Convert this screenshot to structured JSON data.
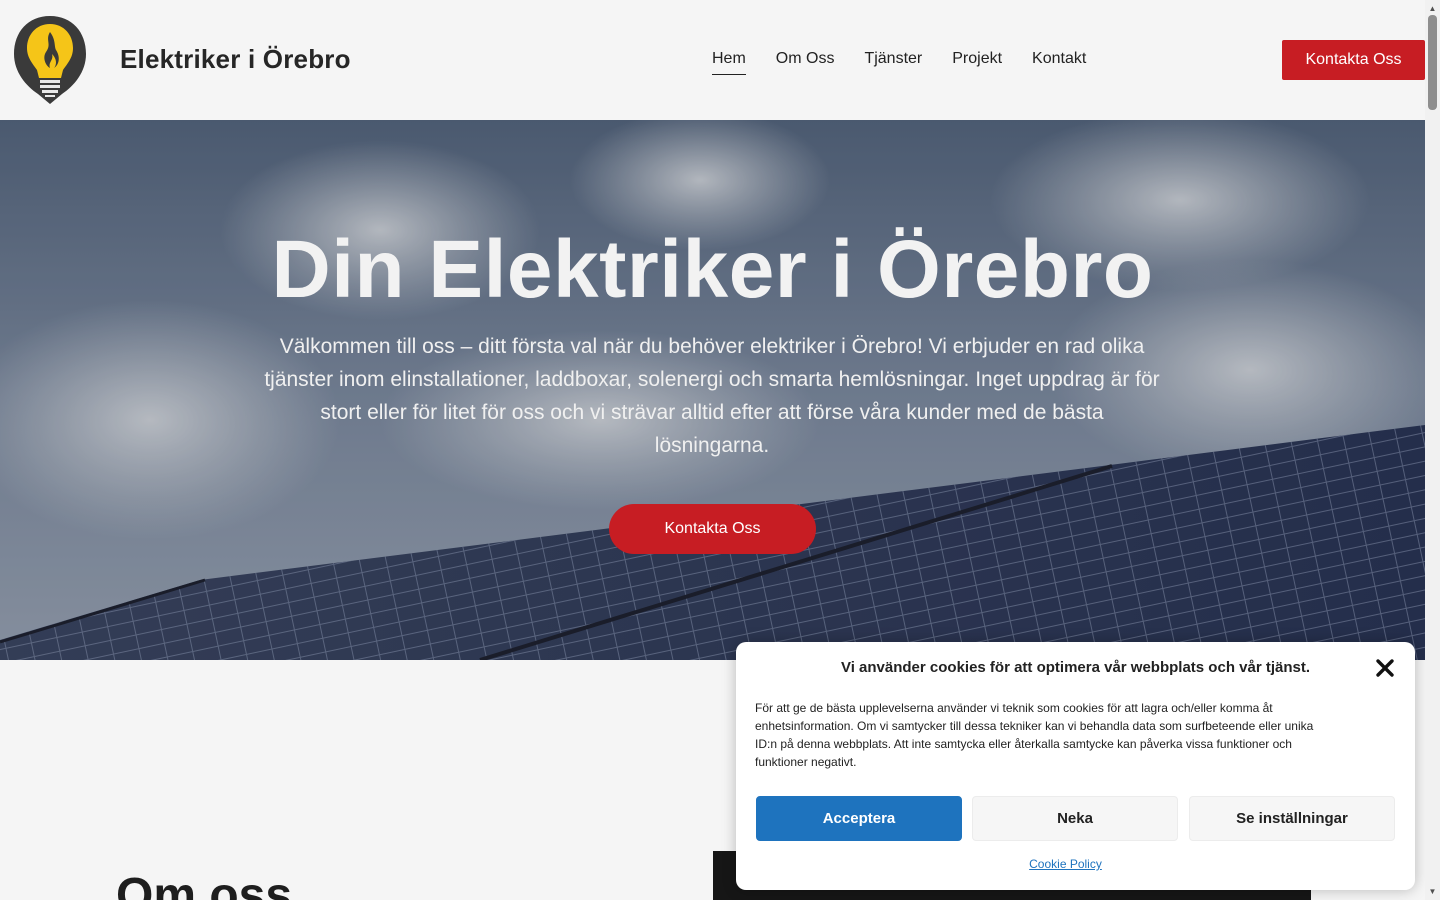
{
  "header": {
    "brand": "Elektriker i Örebro",
    "nav": [
      "Hem",
      "Om Oss",
      "Tjänster",
      "Projekt",
      "Kontakt"
    ],
    "active_nav": "Hem",
    "cta_label": "Kontakta Oss"
  },
  "hero": {
    "title": "Din Elektriker i Örebro",
    "text": "Välkommen till oss – ditt första val när du behöver elektriker i Örebro! Vi erbjuder en rad olika tjänster inom elinstallationer, laddboxar, solenergi och smarta hemlösningar. Inget uppdrag är för stort eller för litet för oss och vi strävar alltid efter att förse våra kunder med de bästa lösningarna.",
    "cta_label": "Kontakta Oss"
  },
  "about": {
    "heading": "Om oss"
  },
  "cookie": {
    "title": "Vi använder cookies för att optimera vår webbplats och vår tjänst.",
    "body": "För att ge de bästa upplevelserna använder vi teknik som cookies för att lagra och/eller komma åt enhetsinformation. Om vi samtycker till dessa tekniker kan vi behandla data som surfbeteende eller unika ID:n på denna webbplats. Att inte samtycka eller återkalla samtycke kan påverka vissa funktioner och funktioner negativt.",
    "accept_label": "Acceptera",
    "deny_label": "Neka",
    "settings_label": "Se inställningar",
    "policy_label": "Cookie Policy"
  },
  "colors": {
    "accent_red": "#c71d23",
    "accept_blue": "#1e73be",
    "logo_yellow": "#f5c518"
  }
}
